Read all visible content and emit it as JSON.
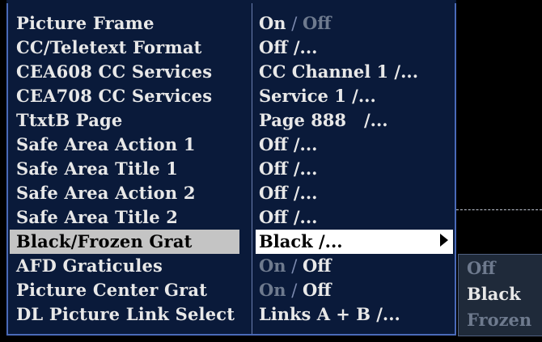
{
  "menu": {
    "rows": [
      {
        "label": "Picture Frame",
        "v1": "On",
        "sep": " / ",
        "v2": "Off"
      },
      {
        "label": "CC/Teletext Format",
        "v1": "Off /..."
      },
      {
        "label": "CEA608 CC Services",
        "v1": "CC Channel 1 /..."
      },
      {
        "label": "CEA708 CC Services",
        "v1": "Service 1 /..."
      },
      {
        "label": "TtxtB Page",
        "v1": "Page 888   /..."
      },
      {
        "label": "Safe Area Action 1",
        "v1": "Off /..."
      },
      {
        "label": "Safe Area Title 1",
        "v1": "Off /..."
      },
      {
        "label": "Safe Area Action 2",
        "v1": "Off /..."
      },
      {
        "label": "Safe Area Title 2",
        "v1": "Off /..."
      },
      {
        "label": "Black/Frozen Grat",
        "v1": "Black /..."
      },
      {
        "label": "AFD Graticules",
        "v1": "On",
        "sep": " / ",
        "v2": "Off"
      },
      {
        "label": "Picture Center Grat",
        "v1": "On",
        "sep": " / ",
        "v2": "Off"
      },
      {
        "label": "DL Picture Link Select",
        "v1": "Links A + B /..."
      }
    ],
    "selected_row": "Black/Frozen Grat"
  },
  "submenu": {
    "items": [
      "Off",
      "Black",
      "Frozen"
    ],
    "selected": "Black"
  },
  "colors": {
    "panel_bg": "#0a1a3a",
    "border": "#4a6ab8",
    "text": "#e8e8e8",
    "dim_text": "#6e7a8e",
    "highlight_label": "#c4c4c4",
    "highlight_value": "#ffffff"
  }
}
